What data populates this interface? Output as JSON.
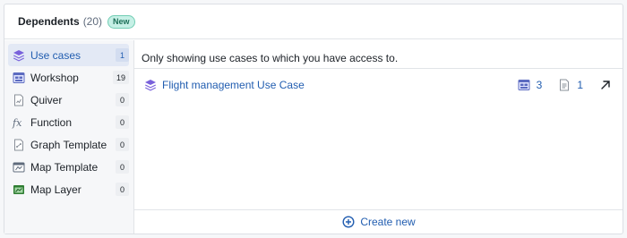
{
  "header": {
    "title": "Dependents",
    "count": "(20)",
    "badge": "New"
  },
  "sidebar": {
    "items": [
      {
        "label": "Use cases",
        "count": "1",
        "icon": "layers-icon"
      },
      {
        "label": "Workshop",
        "count": "19",
        "icon": "workshop-app-icon"
      },
      {
        "label": "Quiver",
        "count": "0",
        "icon": "quiver-icon"
      },
      {
        "label": "Function",
        "count": "0",
        "icon": "function-icon"
      },
      {
        "label": "Graph Template",
        "count": "0",
        "icon": "graph-template-icon"
      },
      {
        "label": "Map Template",
        "count": "0",
        "icon": "map-template-icon"
      },
      {
        "label": "Map Layer",
        "count": "0",
        "icon": "map-layer-icon"
      }
    ]
  },
  "main": {
    "notice": "Only showing use cases to which you have access to.",
    "row": {
      "title": "Flight management Use Case",
      "stat_apps": "3",
      "stat_docs": "1"
    },
    "create_label": "Create new"
  },
  "colors": {
    "accent": "#215db0",
    "active_bg": "#e3e9f5",
    "badge_bg": "#c6f0e6",
    "layers_purple": "#7961db"
  }
}
